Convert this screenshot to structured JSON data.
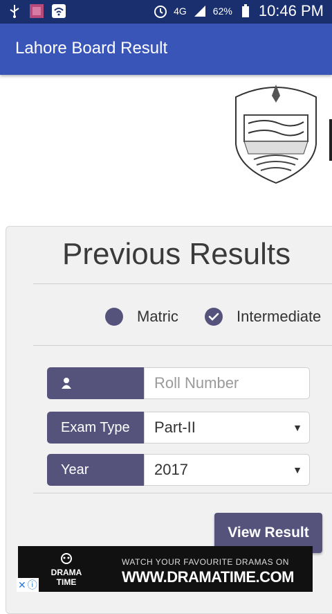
{
  "status_bar": {
    "network": "4G",
    "battery": "62%",
    "time": "10:46 PM"
  },
  "app_bar": {
    "title": "Lahore Board Result"
  },
  "section": {
    "title": "Previous Results"
  },
  "radios": [
    {
      "label": "Matric",
      "checked": false
    },
    {
      "label": "Intermediate",
      "checked": true
    }
  ],
  "form": {
    "roll_placeholder": "Roll Number",
    "exam_type_label": "Exam Type",
    "exam_type_value": "Part-II",
    "year_label": "Year",
    "year_value": "2017"
  },
  "button": {
    "view_result": "View Result"
  },
  "ad": {
    "logo_text": "DRAMA TIME",
    "tagline": "WATCH YOUR FAVOURITE DRAMAS ON",
    "url": "WWW.DRAMATIME.COM"
  },
  "colors": {
    "status_bar": "#1a2f6e",
    "app_bar": "#3a55b8",
    "accent": "#55537c"
  }
}
